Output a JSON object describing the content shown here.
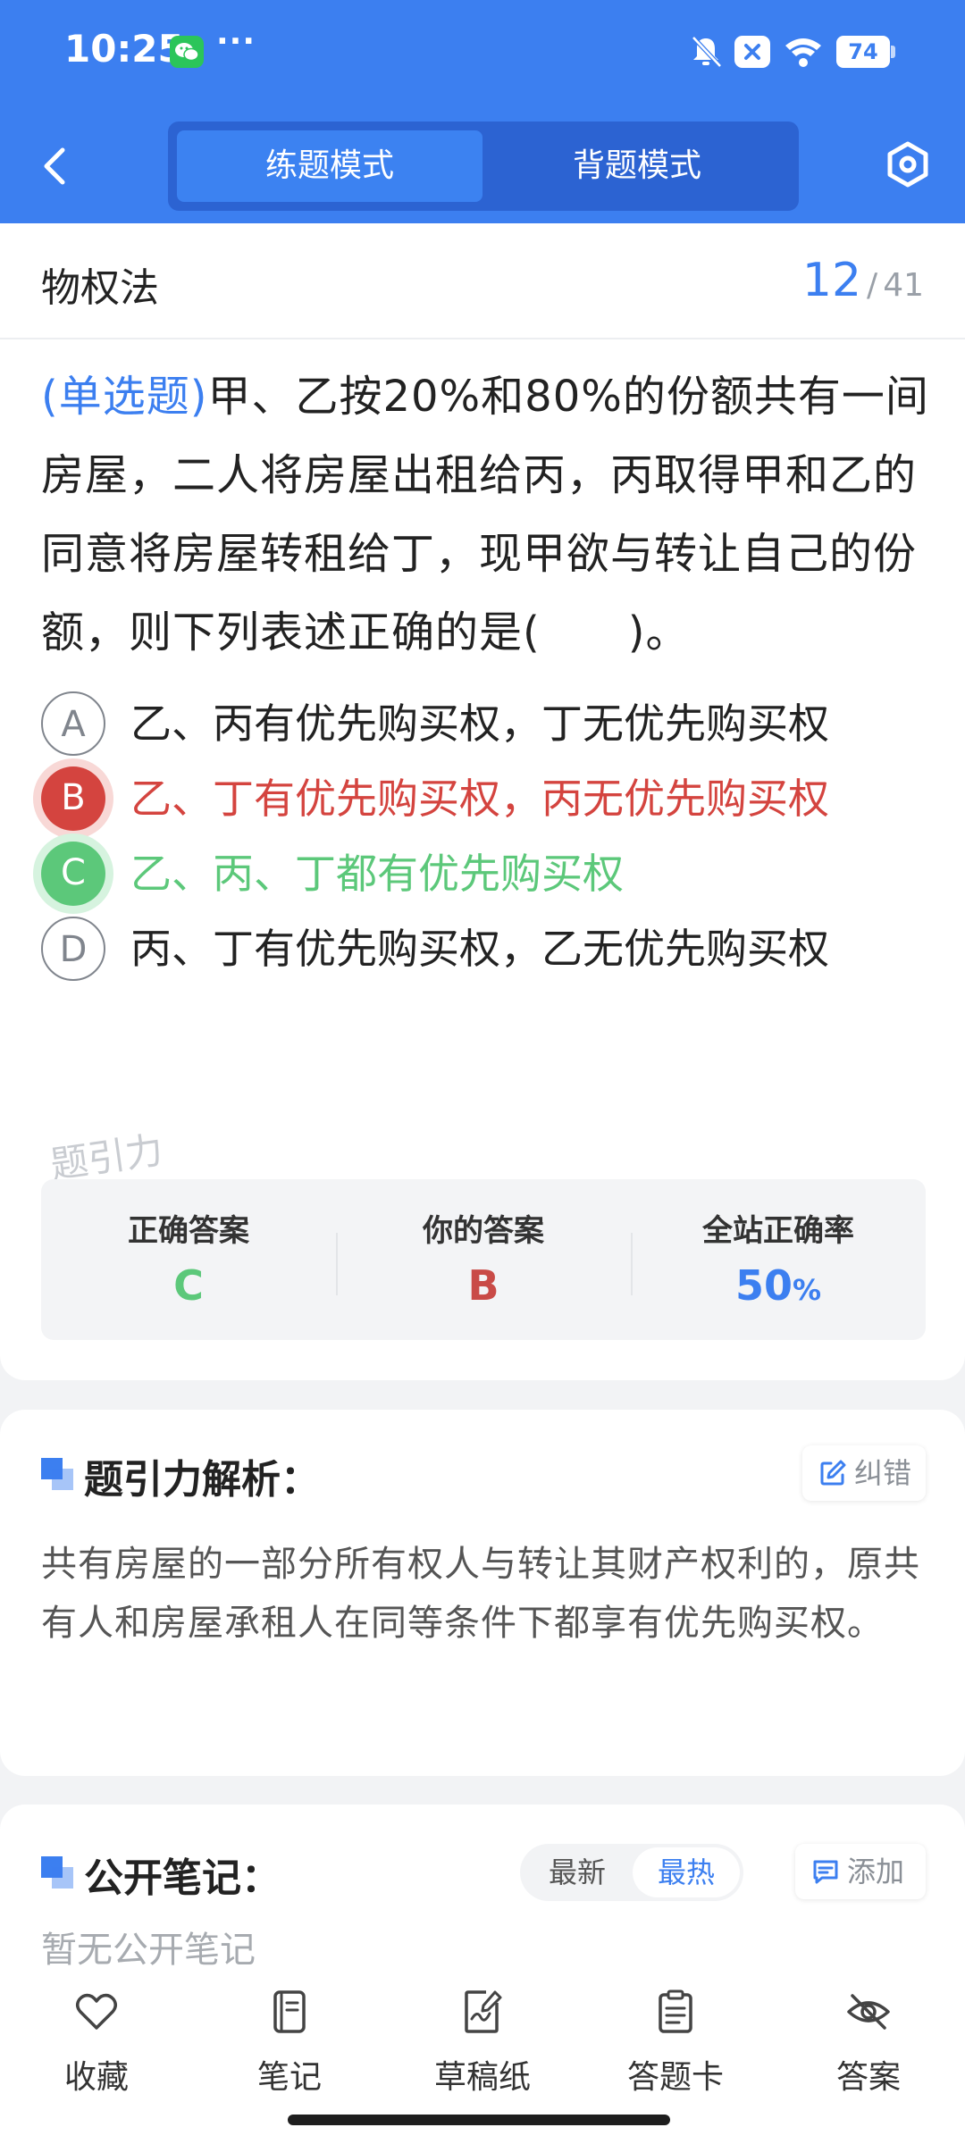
{
  "status_bar": {
    "time": "10:25",
    "more": "···",
    "battery": "74"
  },
  "header": {
    "modes": [
      {
        "label": "练题模式",
        "active": true
      },
      {
        "label": "背题模式",
        "active": false
      }
    ]
  },
  "question": {
    "subject": "物权法",
    "current": "12",
    "separator": "/",
    "total": "41",
    "type": "(单选题)",
    "stem": "甲、乙按20%和80%的份额共有一间房屋，二人将房屋出租给丙，丙取得甲和乙的同意将房屋转租给丁，现甲欲与转让自己的份额，则下列表述正确的是(　　)。",
    "options": [
      {
        "letter": "A",
        "text": "乙、丙有优先购买权，丁无优先购买权",
        "state": "normal"
      },
      {
        "letter": "B",
        "text": "乙、丁有优先购买权，丙无优先购买权",
        "state": "wrong"
      },
      {
        "letter": "C",
        "text": "乙、丙、丁都有优先购买权",
        "state": "correct"
      },
      {
        "letter": "D",
        "text": "丙、丁有优先购买权，乙无优先购买权",
        "state": "normal"
      }
    ],
    "watermark": "题引力"
  },
  "stats": {
    "correct_label": "正确答案",
    "correct_value": "C",
    "yours_label": "你的答案",
    "yours_value": "B",
    "rate_label": "全站正确率",
    "rate_value": "50",
    "rate_unit": "%"
  },
  "analysis": {
    "title": "题引力解析：",
    "report_label": "纠错",
    "text": "共有房屋的一部分所有权人与转让其财产权利的，原共有人和房屋承租人在同等条件下都享有优先购买权。"
  },
  "notes": {
    "title": "公开笔记：",
    "sort_latest": "最新",
    "sort_hottest": "最热",
    "add_label": "添加",
    "empty_text": "暂无公开笔记"
  },
  "bottom_bar": {
    "items": [
      {
        "label": "收藏",
        "icon": "heart-icon"
      },
      {
        "label": "笔记",
        "icon": "notebook-icon"
      },
      {
        "label": "草稿纸",
        "icon": "draft-paper-icon"
      },
      {
        "label": "答题卡",
        "icon": "answer-sheet-icon"
      },
      {
        "label": "答案",
        "icon": "eye-off-icon"
      }
    ]
  },
  "colors": {
    "brand_blue": "#3c7ff0",
    "wrong_red": "#d4443f",
    "correct_green": "#5cc87a"
  }
}
